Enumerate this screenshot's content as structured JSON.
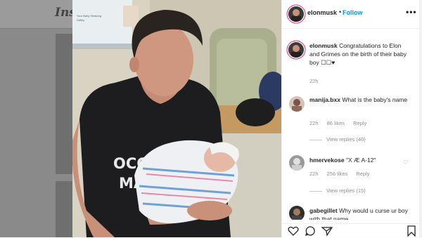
{
  "background": {
    "logo_text": "Insta"
  },
  "photo": {
    "shirt_line1": "OCCUPY",
    "shirt_line2": "MARS",
    "poster_line1": "Your Baby Sleeping",
    "poster_line2": "Safely"
  },
  "header": {
    "username": "elonmusk",
    "separator": "•",
    "follow_label": "Follow",
    "more_icon": "•••"
  },
  "caption": {
    "username": "elonmusk",
    "text": "Congratulations to Elon and Grimes on the birth of their baby boy ☐☐♥",
    "time": "22h"
  },
  "comments": [
    {
      "username": "manija.bxx",
      "text": "What is the baby's name",
      "time": "22h",
      "likes": "86 likes",
      "reply": "Reply",
      "view_replies": "View replies (40)"
    },
    {
      "username": "hmervekose",
      "text": "\"X Æ A-12\"",
      "time": "22h",
      "likes": "256 likes",
      "reply": "Reply",
      "view_replies": "View replies (15)"
    },
    {
      "username": "gabegillet",
      "text": "Why would u curse ur boy with that name",
      "time": "",
      "likes": "",
      "reply": "",
      "view_replies": ""
    }
  ],
  "colors": {
    "follow": "#0095f6",
    "muted": "#8e8e8e"
  }
}
